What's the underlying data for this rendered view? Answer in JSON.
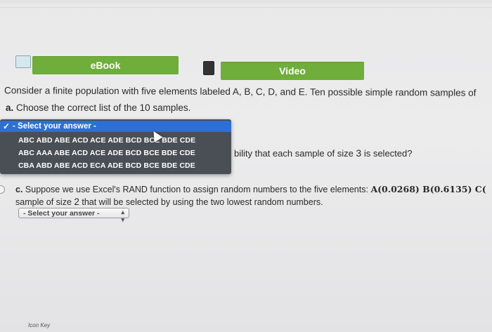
{
  "tabs": {
    "ebook": "eBook",
    "video": "Video"
  },
  "question": {
    "intro_prefix": "Consider a finite population with five elements labeled A, B, C, D, and E. Ten possible simple random samples of",
    "part_a_letter": "a.",
    "part_a_text": " Choose the correct list of the 10 samples."
  },
  "dropdown": {
    "selected": "- Select your answer -",
    "options": [
      "ABC ABD ABE ACD ACE ADE BCD BCE BDE CDE",
      "ABC AAA ABE ACD ACE ADE BCD BCE BDE CDE",
      "CBA ABD ABE ACD ECA ADE BCD BCE BDE CDE"
    ]
  },
  "part_b": {
    "text_before": "bility that each sample of size ",
    "num": "3",
    "text_after": " is selected?"
  },
  "part_c": {
    "letter": "c.",
    "line1": " Suppose we use Excel's RAND function to assign random numbers to the five elements: ",
    "line1_math": "A(0.0268) B(0.6135) C(",
    "line2_before": "sample of size ",
    "line2_num": "2",
    "line2_after": " that will be selected by using the two lowest random numbers.",
    "select_label": "- Select your answer -"
  },
  "footer": {
    "text": "Icon Key"
  }
}
